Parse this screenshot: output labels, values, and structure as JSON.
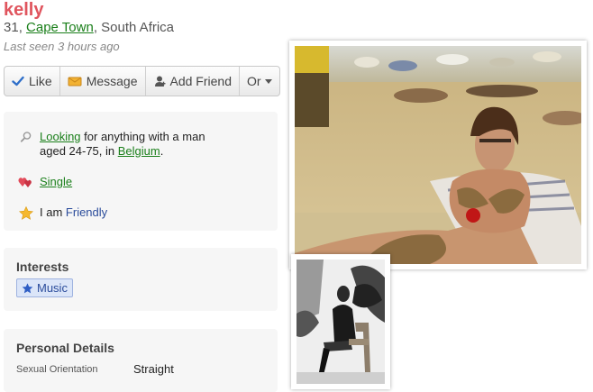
{
  "profile": {
    "name": "kelly",
    "age": "31",
    "age_sep": ", ",
    "city": "Cape Town",
    "country_sep": ", South Africa",
    "last_seen": "Last seen 3 hours ago"
  },
  "actions": {
    "like": "Like",
    "message": "Message",
    "add_friend": "Add Friend",
    "or": "Or"
  },
  "summary": {
    "looking_link": "Looking",
    "looking_text_1": " for anything with a man",
    "looking_text_2": "aged 24-75, in ",
    "looking_place": "Belgium",
    "looking_end": ".",
    "status": "Single",
    "iam_prefix": "I am ",
    "iam_value": "Friendly"
  },
  "interests": {
    "title": "Interests",
    "items": [
      "Music"
    ]
  },
  "personal": {
    "title": "Personal Details",
    "rows": [
      {
        "label": "Sexual Orientation",
        "value": "Straight"
      }
    ]
  },
  "colors": {
    "name": "#e0555e",
    "link": "#1a7f1a",
    "accent_blue": "#2b4c9b"
  },
  "icons": {
    "like": "check-icon",
    "message": "envelope-icon",
    "add_friend": "person-plus-icon",
    "or": "caret-down-icon",
    "looking": "magnifier-icon",
    "status": "hearts-icon",
    "iam": "star-icon",
    "interest": "star-icon"
  }
}
